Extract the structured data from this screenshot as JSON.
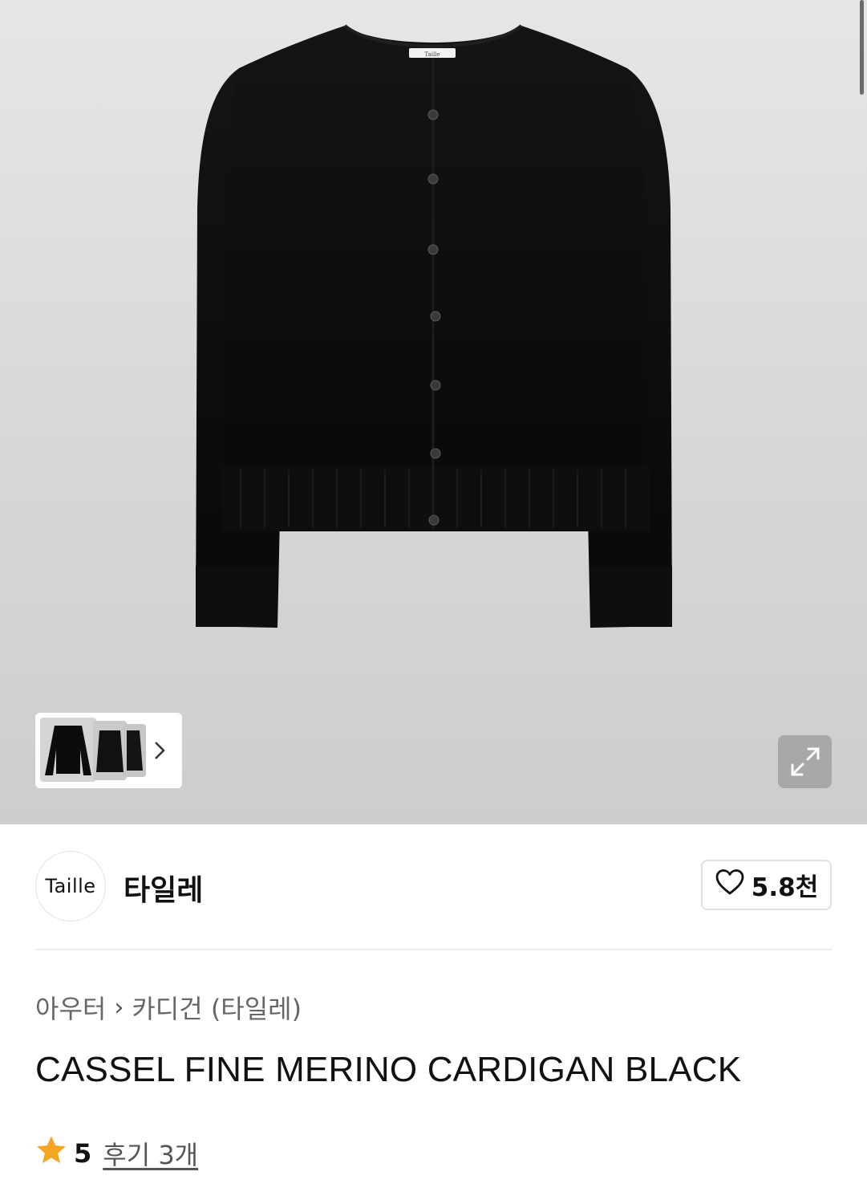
{
  "gallery": {
    "garment_label": "Taille",
    "thumbnail_count": 3,
    "next_icon": "chevron-right-icon",
    "expand_icon": "expand-icon"
  },
  "brand": {
    "logo_text": "Taille",
    "name": "타일레",
    "likes": "5.8천",
    "like_icon": "heart-outline-icon"
  },
  "breadcrumb": {
    "items": [
      "아우터",
      "카디건 (타일레)"
    ],
    "separator": "›"
  },
  "product": {
    "title": "CASSEL FINE MERINO CARDIGAN BLACK"
  },
  "rating": {
    "score": "5",
    "reviews_label": "후기 3개",
    "star_color": "#f5a623"
  },
  "colors": {
    "garment": "#0c0c0c",
    "hero_background": "#dcdcdc",
    "text": "#111111",
    "muted_text": "#666666"
  }
}
